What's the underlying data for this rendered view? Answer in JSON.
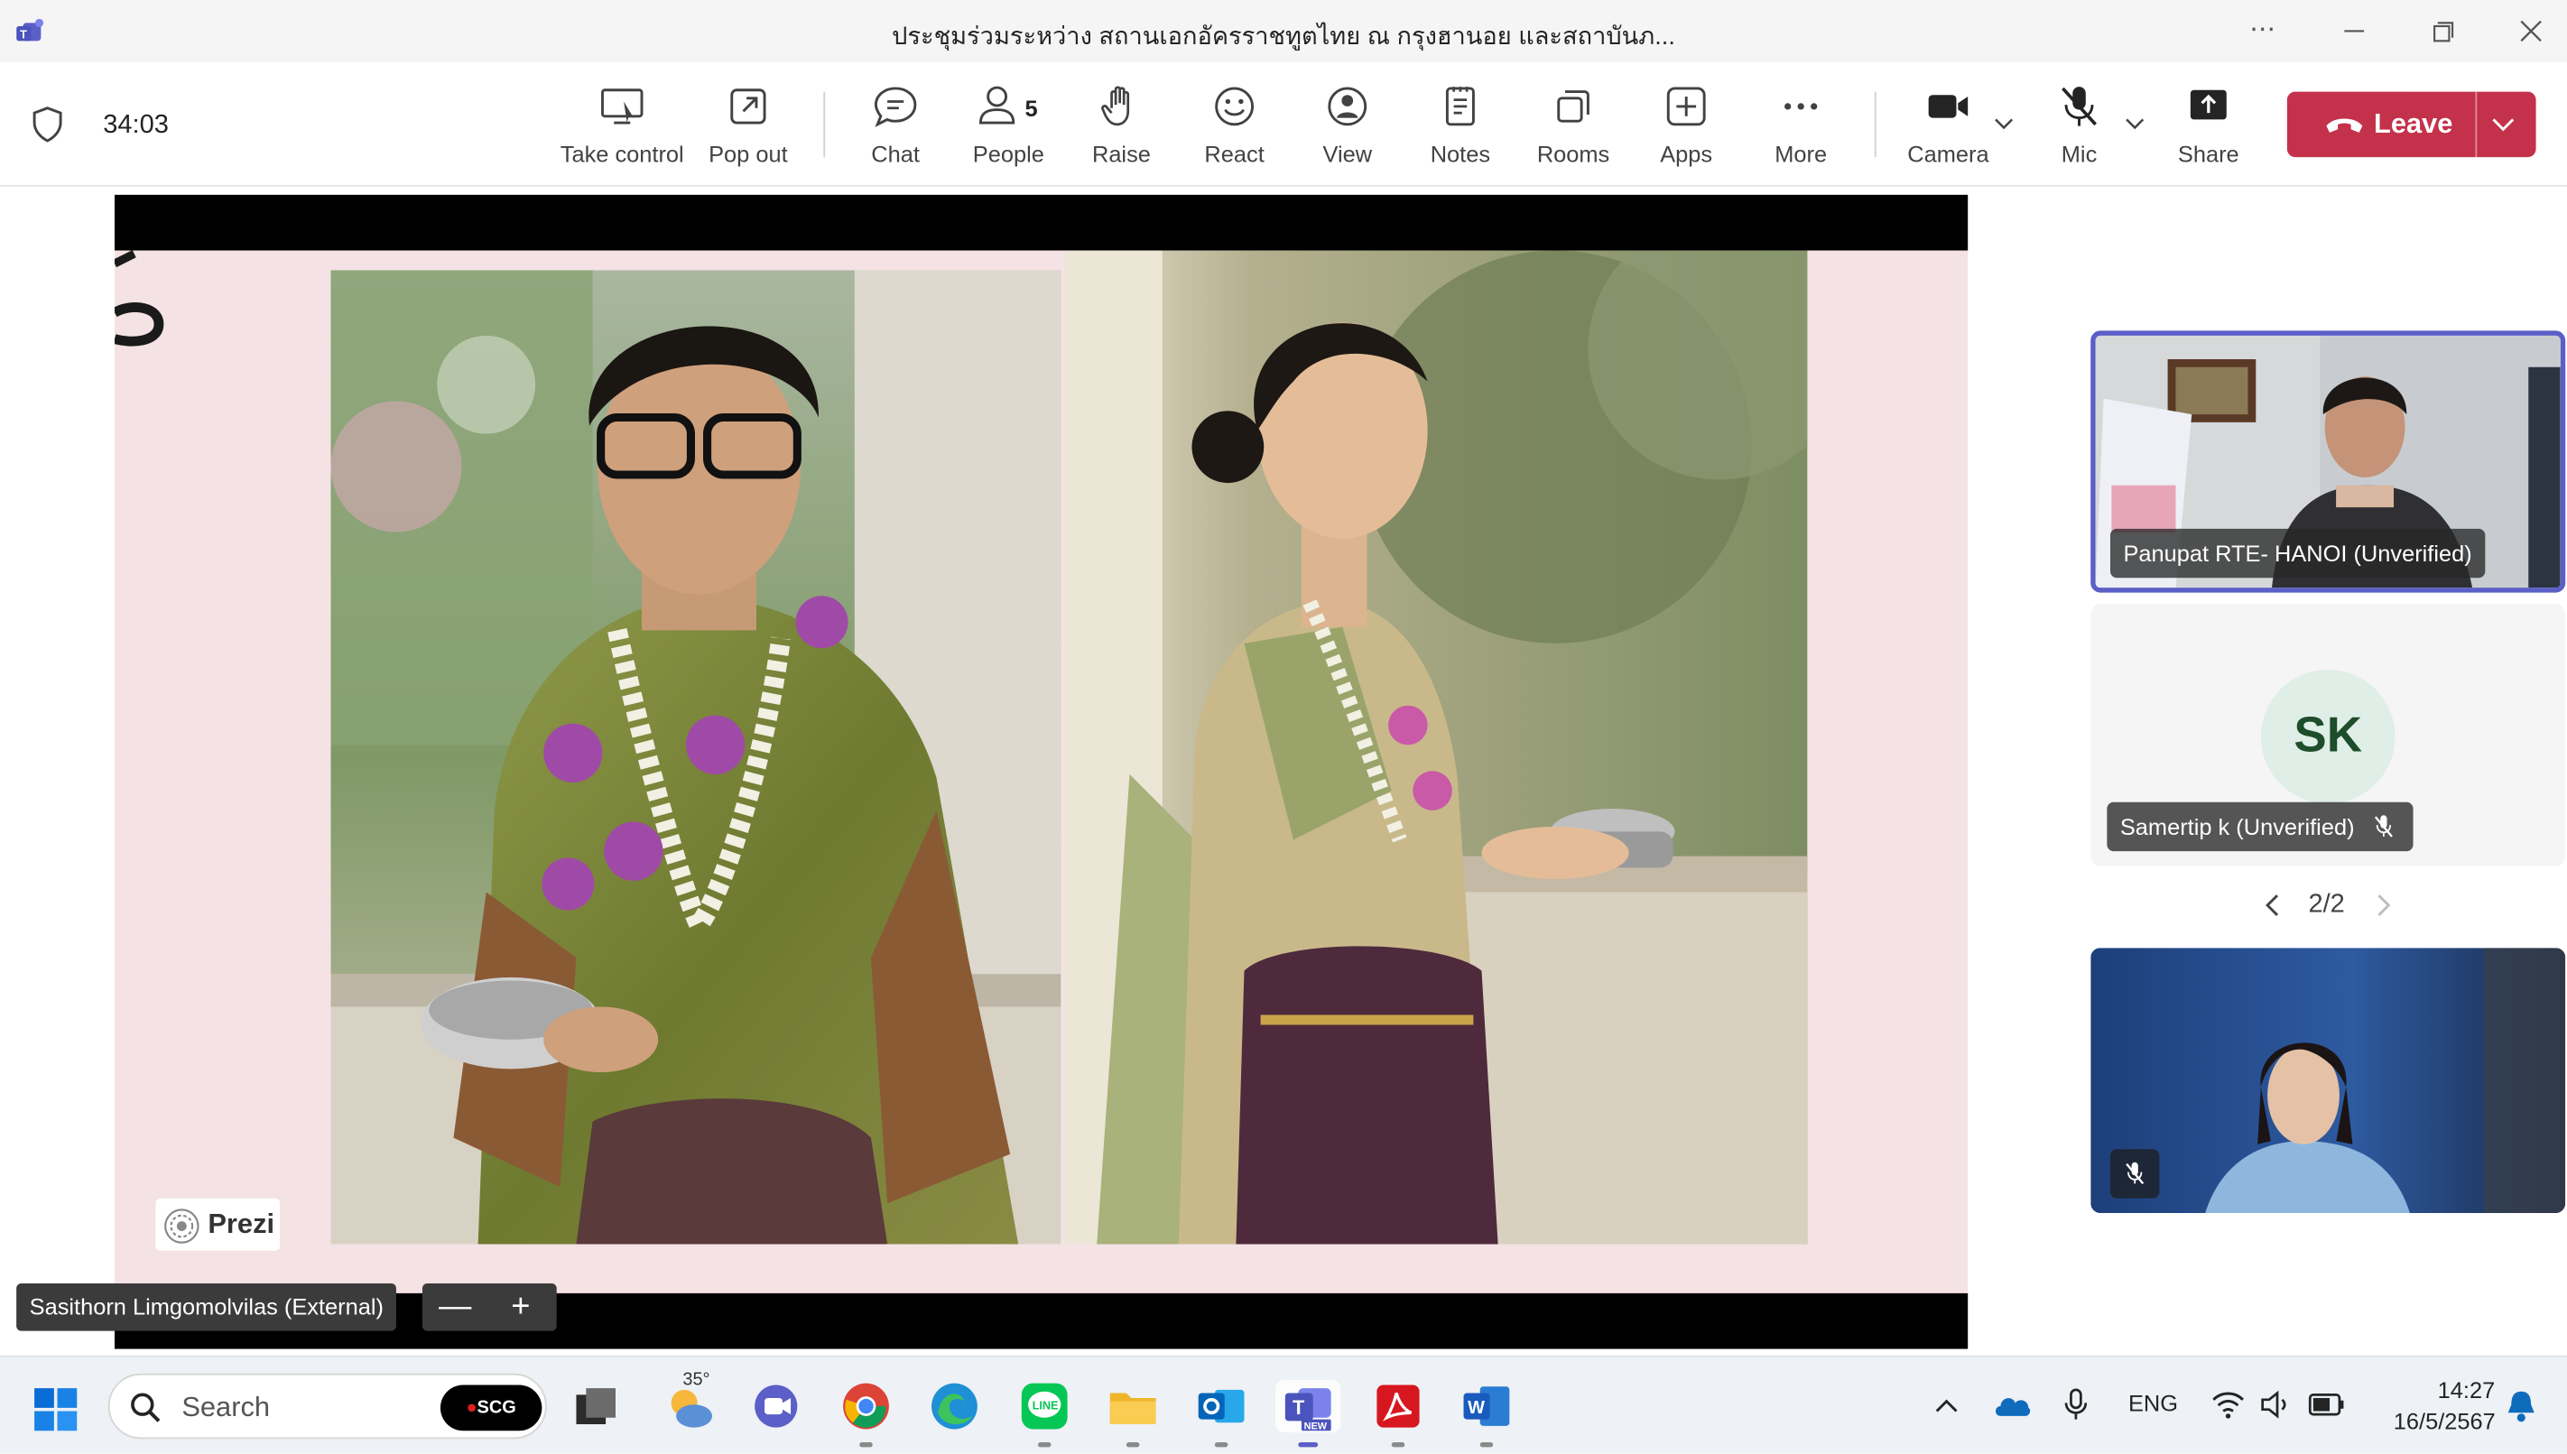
{
  "window": {
    "title": "ประชุมร่วมระหว่าง สถานเอกอัครราชทูตไทย ณ กรุงฮานอย และสถาบันภ...",
    "more_icon": "ellipsis-icon",
    "minimize_icon": "minimize-icon",
    "restore_icon": "restore-icon",
    "close_icon": "close-icon"
  },
  "meeting": {
    "timer": "34:03"
  },
  "toolbar": {
    "take_control": "Take control",
    "pop_out": "Pop out",
    "chat": "Chat",
    "people": "People",
    "people_count": "5",
    "raise": "Raise",
    "react": "React",
    "view": "View",
    "notes": "Notes",
    "rooms": "Rooms",
    "apps": "Apps",
    "more": "More",
    "camera": "Camera",
    "mic": "Mic",
    "share": "Share",
    "leave": "Leave"
  },
  "stage": {
    "presenter_name": "Sasithorn Limgomolvilas (External)",
    "zoom_out": "—",
    "zoom_in": "+",
    "prezi_logo": "Prezi"
  },
  "participants": {
    "pager": "2/2",
    "items": [
      {
        "name": "Panupat RTE- HANOI (Unverified)"
      },
      {
        "name": "Samertip k (Unverified)",
        "initials": "SK",
        "muted": true
      },
      {
        "muted": true
      }
    ]
  },
  "taskbar": {
    "search_placeholder": "Search",
    "search_badge": "SCG",
    "weather": "35°",
    "language": "ENG",
    "time": "14:27",
    "date": "16/5/2567",
    "accent": "#c4314b",
    "teams_accent": "#5b5fc7"
  }
}
